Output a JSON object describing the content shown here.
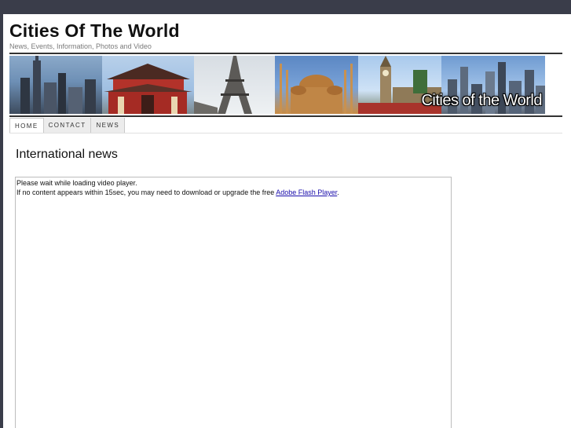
{
  "site": {
    "title": "Cities Of The World",
    "tagline": "News, Events, Information, Photos and Video"
  },
  "banner": {
    "caption": "Cities of the World",
    "panels": [
      "new-york-skyline",
      "tokyo-temple",
      "eiffel-tower",
      "blue-mosque",
      "big-ben",
      "hong-kong-skyline"
    ]
  },
  "nav": {
    "items": [
      {
        "label": "HOME",
        "active": true
      },
      {
        "label": "CONTACT",
        "active": false
      },
      {
        "label": "NEWS",
        "active": false
      }
    ]
  },
  "main": {
    "heading": "International news",
    "player": {
      "loading_text": "Please wait while loading video player.",
      "hint_text": "If no content appears within 15sec, you may need to download or upgrade the free ",
      "link_text": "Adobe Flash Player",
      "trailing": "."
    }
  },
  "colors": {
    "outer_background": "#3a3d4a",
    "page_background": "#ffffff",
    "link": "#1a0dab"
  }
}
